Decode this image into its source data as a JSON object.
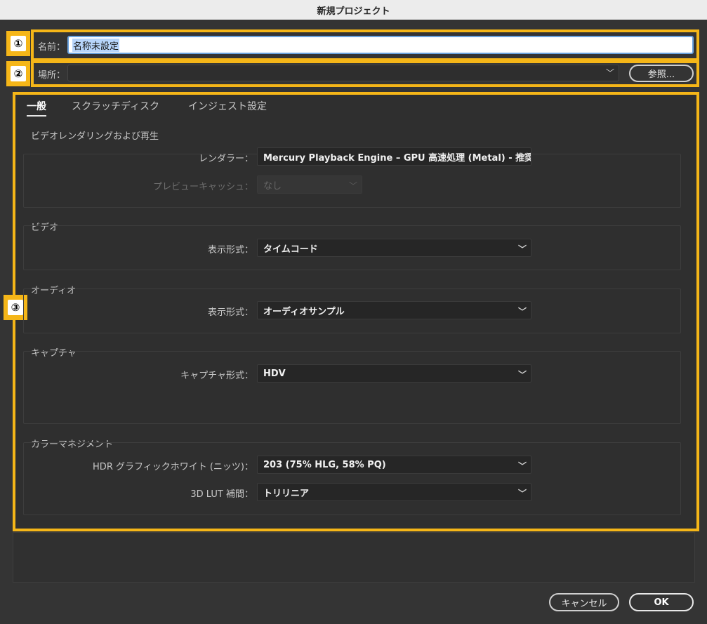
{
  "window": {
    "title": "新規プロジェクト"
  },
  "markers": [
    "①",
    "②",
    "③"
  ],
  "name": {
    "label": "名前：",
    "value": "名称未設定"
  },
  "location": {
    "label": "場所：",
    "value": "",
    "browse_label": "参照..."
  },
  "tabs": [
    {
      "label": "一般",
      "active": true
    },
    {
      "label": "スクラッチディスク",
      "active": false
    },
    {
      "label": "インジェスト設定",
      "active": false
    }
  ],
  "sections": {
    "video_rendering": {
      "title": "ビデオレンダリングおよび再生",
      "renderer_label": "レンダラー：",
      "renderer_value": "Mercury Playback Engine – GPU 高速処理 (Metal) - 推奨",
      "preview_cache_label": "プレビューキャッシュ：",
      "preview_cache_value": "なし"
    },
    "video": {
      "title": "ビデオ",
      "display_format_label": "表示形式：",
      "display_format_value": "タイムコード"
    },
    "audio": {
      "title": "オーディオ",
      "display_format_label": "表示形式：",
      "display_format_value": "オーディオサンプル"
    },
    "capture": {
      "title": "キャプチャ",
      "capture_format_label": "キャプチャ形式：",
      "capture_format_value": "HDV"
    },
    "color": {
      "title": "カラーマネジメント",
      "hdr_label": "HDR グラフィックホワイト (ニッツ)：",
      "hdr_value": "203 (75% HLG, 58% PQ)",
      "lut_label": "3D LUT 補間：",
      "lut_value": "トリリニア"
    }
  },
  "footer": {
    "cancel_label": "キャンセル",
    "ok_label": "OK"
  },
  "colors": {
    "highlight": "#f5b618",
    "background": "#343434",
    "selection": "#b7d5fb"
  },
  "icons": {
    "dropdown": "chevron-down-icon"
  }
}
